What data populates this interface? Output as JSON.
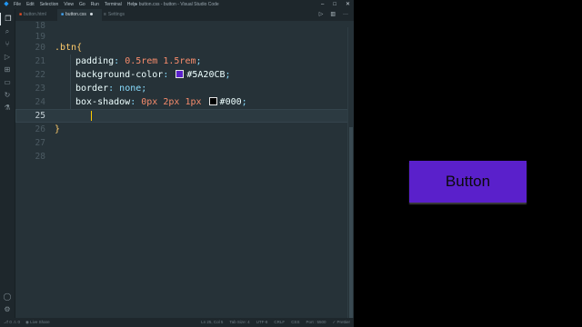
{
  "titlebar": {
    "menu": [
      "File",
      "Edit",
      "Selection",
      "View",
      "Go",
      "Run",
      "Terminal",
      "Help"
    ],
    "title": "● button.css - button - Visual Studio Code"
  },
  "tabs": [
    {
      "label": "button.html",
      "icon": "html-icon",
      "color": "#e44d26"
    },
    {
      "label": "button.css",
      "icon": "css-icon",
      "color": "#42a5f5",
      "modified": true
    },
    {
      "label": "Settings",
      "icon": "settings-icon",
      "color": "#7f8c93"
    }
  ],
  "editor": {
    "lines": [
      {
        "n": "18"
      },
      {
        "n": "19"
      },
      {
        "n": "20"
      },
      {
        "n": "21"
      },
      {
        "n": "22"
      },
      {
        "n": "23"
      },
      {
        "n": "24"
      },
      {
        "n": "25",
        "current": true
      },
      {
        "n": "26"
      },
      {
        "n": "27"
      },
      {
        "n": "28"
      }
    ],
    "code": {
      "selector": ".btn",
      "open_brace": "{",
      "close_brace": "}",
      "padding_prop": "padding",
      "padding_val1": "0.5rem",
      "padding_val2": "1.5rem",
      "bg_prop": "background-color",
      "bg_val": "#5A20CB",
      "border_prop": "border",
      "border_val": "none",
      "shadow_prop": "box-shadow",
      "shadow_x": "0px",
      "shadow_y": "2px",
      "shadow_blur": "1px",
      "shadow_color": "#000"
    },
    "colors": {
      "bg_swatch": "#5A20CB",
      "shadow_swatch": "#000000"
    }
  },
  "statusbar": {
    "left": [
      "⎇ 0 ⚠ 0",
      "◉ Live Share"
    ],
    "right": [
      "Ln 25, Col 5",
      "Tab Size: 4",
      "UTF-8",
      "CRLF",
      "CSS",
      "Port : 5500",
      "✓ Prettier"
    ]
  },
  "preview": {
    "button_label": "Button",
    "button_color": "#5A20CB"
  }
}
